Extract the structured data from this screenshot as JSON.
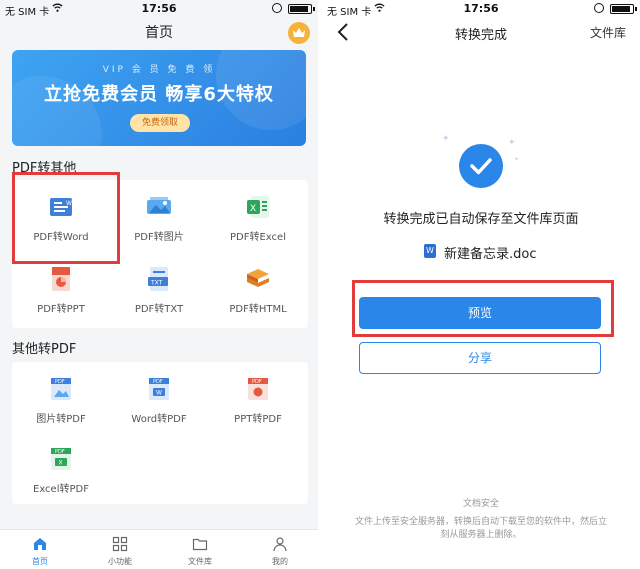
{
  "status_left": {
    "carrier": "无 SIM 卡",
    "time": "17:56"
  },
  "status_right": {
    "carrier": "无 SIM 卡",
    "time": "17:56"
  },
  "home": {
    "title": "首页",
    "banner": {
      "subtitle": "VIP 会 员 免 费 领",
      "headline": "立抢免费会员   畅享6大特权",
      "button": "免费领取"
    },
    "section_pdf_to_other": {
      "title": "PDF转其他",
      "items": [
        {
          "label": "PDF转Word",
          "icon": "word-doc-icon"
        },
        {
          "label": "PDF转图片",
          "icon": "image-icon"
        },
        {
          "label": "PDF转Excel",
          "icon": "excel-icon"
        },
        {
          "label": "PDF转PPT",
          "icon": "ppt-icon"
        },
        {
          "label": "PDF转TXT",
          "icon": "txt-icon"
        },
        {
          "label": "PDF转HTML",
          "icon": "html-icon"
        }
      ]
    },
    "section_other_to_pdf": {
      "title": "其他转PDF",
      "items": [
        {
          "label": "图片转PDF",
          "icon": "image-to-pdf-icon"
        },
        {
          "label": "Word转PDF",
          "icon": "word-to-pdf-icon"
        },
        {
          "label": "PPT转PDF",
          "icon": "ppt-to-pdf-icon"
        },
        {
          "label": "Excel转PDF",
          "icon": "excel-to-pdf-icon"
        }
      ]
    },
    "tabs": [
      {
        "label": "首页",
        "icon": "home-icon",
        "active": true
      },
      {
        "label": "小功能",
        "icon": "grid-icon",
        "active": false
      },
      {
        "label": "文件库",
        "icon": "folder-icon",
        "active": false
      },
      {
        "label": "我的",
        "icon": "person-icon",
        "active": false
      }
    ]
  },
  "result": {
    "title": "转换完成",
    "action": "文件库",
    "message": "转换完成已自动保存至文件库页面",
    "file_icon_letter": "W",
    "file_name": "新建备忘录.doc",
    "preview_button": "预览",
    "share_button": "分享",
    "security_title": "文档安全",
    "security_desc": "文件上传至安全服务器，转换后自动下载至您的软件中，然后立刻从服务器上删除。"
  },
  "colors": {
    "accent": "#2a86e8",
    "highlight": "#e23b3b",
    "gold": "#f6b23b"
  }
}
